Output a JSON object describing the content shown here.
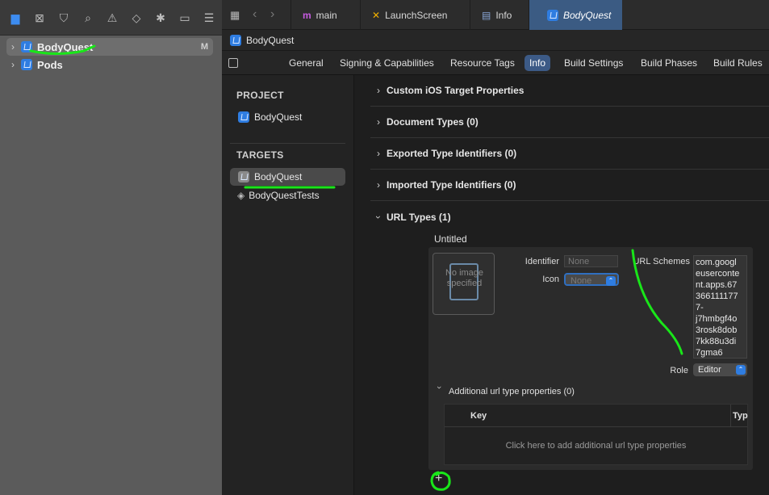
{
  "navigator": {
    "items": [
      {
        "label": "BodyQuest",
        "badge": "M"
      },
      {
        "label": "Pods"
      }
    ]
  },
  "tabs": [
    {
      "label": "main",
      "icon": "m-icon"
    },
    {
      "label": "LaunchScreen",
      "icon": "storyboard-icon"
    },
    {
      "label": "Info",
      "icon": "table-icon"
    },
    {
      "label": "BodyQuest",
      "icon": "app-icon"
    }
  ],
  "jumpbar": {
    "label": "BodyQuest"
  },
  "settings_tabs": [
    "General",
    "Signing & Capabilities",
    "Resource Tags",
    "Info",
    "Build Settings",
    "Build Phases",
    "Build Rules"
  ],
  "project": {
    "header": "PROJECT",
    "item": "BodyQuest"
  },
  "targets": {
    "header": "TARGETS",
    "items": [
      "BodyQuest",
      "BodyQuestTests"
    ]
  },
  "sections": [
    "Custom iOS Target Properties",
    "Document Types (0)",
    "Exported Type Identifiers (0)",
    "Imported Type Identifiers (0)",
    "URL Types (1)"
  ],
  "url_type": {
    "title": "Untitled",
    "image_placeholder": "No image specified",
    "identifier_label": "Identifier",
    "identifier_placeholder": "None",
    "icon_label": "Icon",
    "icon_value": "None",
    "url_schemes_label": "URL Schemes",
    "url_schemes_lines": [
      "com.googl",
      "euserconte",
      "nt.apps.67",
      "366111177",
      "7-",
      "j7hmbgf4o",
      "3rosk8dob",
      "7kk88u3di",
      "7gma6"
    ],
    "role_label": "Role",
    "role_value": "Editor",
    "additional_label": "Additional url type properties (0)",
    "table_key": "Key",
    "table_type": "Typ",
    "add_hint": "Click here to add additional url type properties"
  },
  "add_button": "+",
  "colors": {
    "accent": "#2f7de1",
    "annotation": "#19e619",
    "selected_tab": "#3b5b83"
  }
}
